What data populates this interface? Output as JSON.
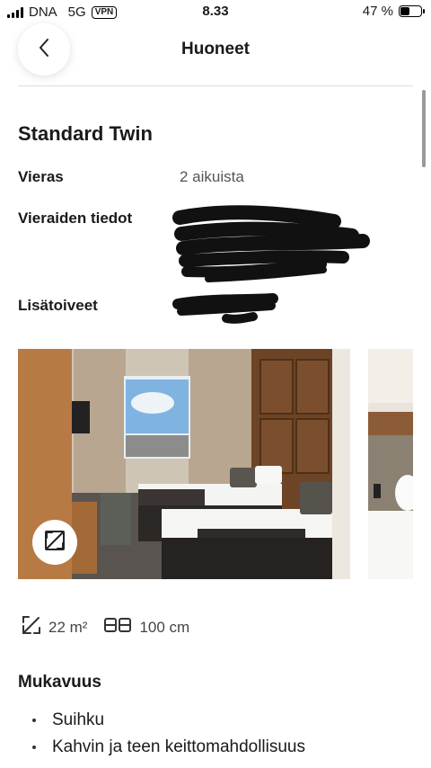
{
  "status_bar": {
    "carrier": "DNA",
    "network": "5G",
    "vpn": "VPN",
    "time": "8.33",
    "battery_percent": "47 %",
    "battery_level": 0.47
  },
  "header": {
    "title": "Huoneet",
    "back_icon": "chevron-left-icon"
  },
  "room": {
    "name": "Standard Twin",
    "guests_label": "Vieras",
    "guests_value": "2 aikuista",
    "guest_details_label": "Vieraiden tiedot",
    "special_requests_label": "Lisätoiveet"
  },
  "gallery": {
    "expand_icon": "expand-icon",
    "photo_count_visible": 2
  },
  "specs": {
    "size_icon": "resize-icon",
    "size": "22 m²",
    "bed_icon": "bed-icon",
    "bed_width": "100 cm"
  },
  "amenities": {
    "title": "Mukavuus",
    "items": [
      "Suihku",
      "Kahvin ja teen keittomahdollisuus"
    ]
  },
  "colors": {
    "text": "#1a1a1a",
    "muted": "#555555",
    "divider": "#dddddd",
    "redaction": "#111111"
  }
}
